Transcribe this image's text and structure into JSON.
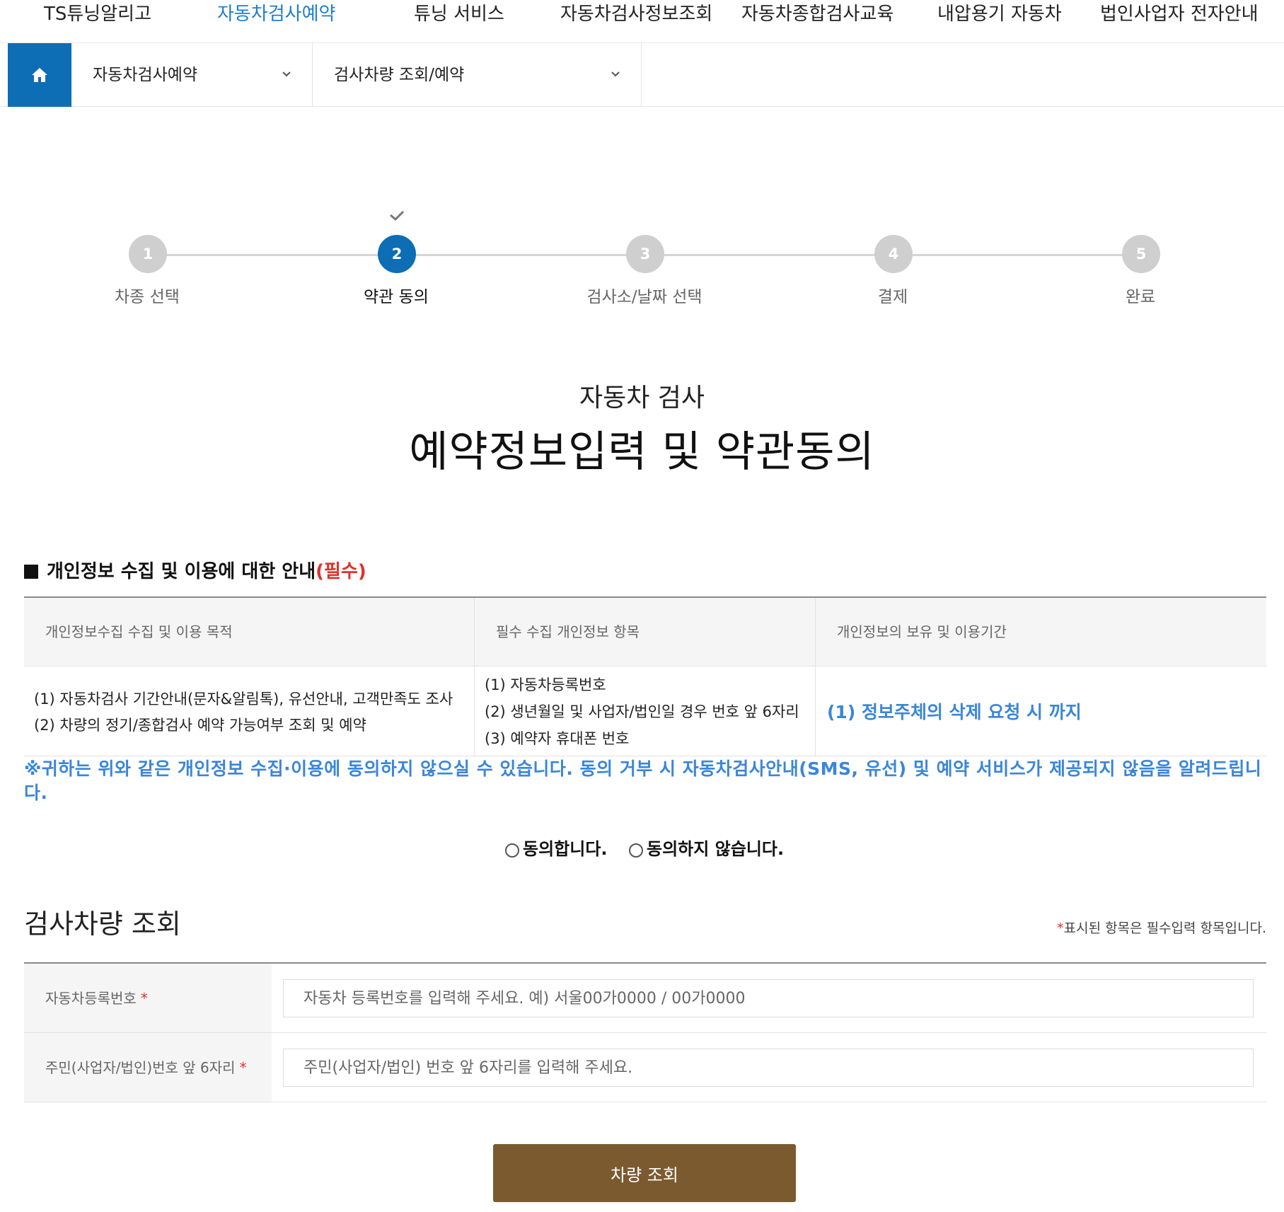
{
  "topnav": {
    "items": [
      "TS튜닝알리고",
      "자동차검사예약",
      "튜닝 서비스",
      "자동차검사정보조회",
      "자동차종합검사교육",
      "내압용기 자동차",
      "법인사업자 전자안내"
    ],
    "active_index": 1
  },
  "breadcrumb": {
    "home_icon": "home-icon",
    "level1": "자동차검사예약",
    "level2": "검사차량 조회/예약"
  },
  "steps": {
    "items": [
      {
        "number": "1",
        "label": "차종 선택"
      },
      {
        "number": "2",
        "label": "약관 동의"
      },
      {
        "number": "3",
        "label": "검사소/날짜 선택"
      },
      {
        "number": "4",
        "label": "결제"
      },
      {
        "number": "5",
        "label": "완료"
      }
    ],
    "current": 2
  },
  "heading": {
    "subtitle": "자동차 검사",
    "title": "예약정보입력 및 약관동의"
  },
  "privacy": {
    "section_title": "개인정보 수집 및 이용에 대한 안내",
    "required_tag": "(필수)",
    "headers": [
      "개인정보수집 수집 및 이용 목적",
      "필수 수집 개인정보 항목",
      "개인정보의 보유 및 이용기간"
    ],
    "purpose": [
      "(1) 자동차검사 기간안내(문자&알림톡), 유선안내, 고객만족도 조사",
      "(2) 차량의 정기/종합검사 예약 가능여부 조회 및 예약"
    ],
    "items": [
      "(1) 자동차등록번호",
      "(2) 생년월일 및 사업자/법인일 경우 번호 앞 6자리",
      "(3) 예약자 휴대폰 번호"
    ],
    "retention": "(1) 정보주체의 삭제 요청 시 까지",
    "notice": "※귀하는 위와 같은 개인정보 수집·이용에 동의하지 않으실 수 있습니다. 동의 거부 시 자동차검사안내(SMS, 유선) 및 예약 서비스가 제공되지 않음을 알려드립니다.",
    "agree_label": "동의합니다.",
    "disagree_label": "동의하지 않습니다."
  },
  "lookup": {
    "title": "검사차량 조회",
    "required_note_star": "*",
    "required_note": "표시된 항목은 필수입력 항목입니다.",
    "fields": [
      {
        "label": "자동차등록번호",
        "star": "*",
        "value": "",
        "placeholder": "자동차 등록번호를 입력해 주세요. 예) 서울00가0000 / 00가0000"
      },
      {
        "label": "주민(사업자/법인)번호 앞 6자리",
        "star": "*",
        "value": "",
        "placeholder": "주민(사업자/법인) 번호 앞 6자리를 입력해 주세요."
      }
    ],
    "submit_label": "차량 조회"
  },
  "colors": {
    "primary": "#0d6db5",
    "link_blue": "#1d7ed1",
    "notice_blue": "#3a86d8",
    "required_red": "#e0322c",
    "submit_brown": "#7b5a30",
    "step_inactive": "#cfcfcf"
  }
}
